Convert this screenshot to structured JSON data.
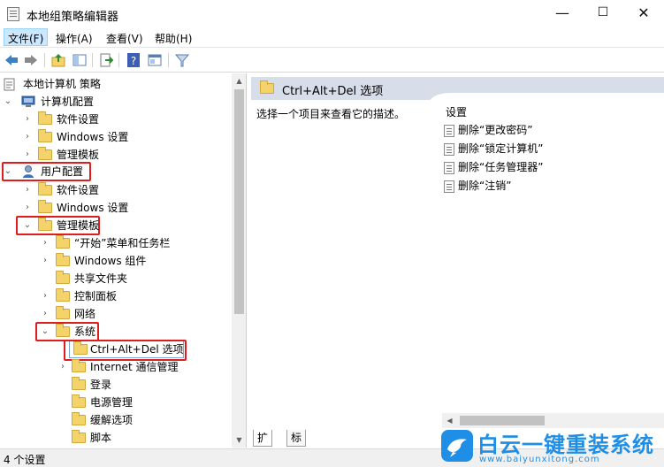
{
  "window": {
    "title": "本地组策略编辑器",
    "minimize_glyph": "—",
    "maximize_glyph": "☐",
    "close_glyph": "✕"
  },
  "menu": {
    "file": "文件(F)",
    "action": "操作(A)",
    "view": "查看(V)",
    "help": "帮助(H)"
  },
  "toolbar": {
    "icons": [
      "back-arrow-icon",
      "forward-arrow-icon",
      "up-folder-icon",
      "show-hide-tree-icon",
      "export-list-icon",
      "help-icon",
      "properties-icon",
      "filter-icon"
    ]
  },
  "tree": {
    "root": "本地计算机 策略",
    "computer_config": "计算机配置",
    "cc_software": "软件设置",
    "cc_windows": "Windows 设置",
    "cc_admin": "管理模板",
    "user_config": "用户配置",
    "uc_software": "软件设置",
    "uc_windows": "Windows 设置",
    "uc_admin": "管理模板",
    "start_menu": "“开始”菜单和任务栏",
    "win_components": "Windows 组件",
    "shared_folders": "共享文件夹",
    "control_panel": "控制面板",
    "network": "网络",
    "system": "系统",
    "ctrl_alt_del": "Ctrl+Alt+Del 选项",
    "internet_comm": "Internet 通信管理",
    "logon": "登录",
    "power": "电源管理",
    "mitigation": "缓解选项",
    "scripts": "脚本"
  },
  "details": {
    "header_title": "Ctrl+Alt+Del 选项",
    "description": "选择一个项目来查看它的描述。",
    "settings_header": "设置",
    "settings": [
      "删除“更改密码”",
      "删除“锁定计算机”",
      "删除“任务管理器”",
      "删除“注销”"
    ]
  },
  "tabs": {
    "extended": "扩展",
    "standard": "标准"
  },
  "status": {
    "text": "4 个设置"
  },
  "watermark": {
    "title": "白云一键重装系统",
    "url": "www.baiyunxitong.com"
  },
  "colors": {
    "highlight": "#e11c1c",
    "header_bg": "#d7dde9",
    "folder": "#f4d36b",
    "brand": "#1f8ee6"
  }
}
